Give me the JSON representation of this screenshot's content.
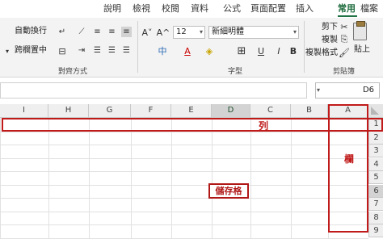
{
  "ribbon_tabs": [
    "檔案",
    "常用",
    "插入",
    "頁面配置",
    "公式",
    "資料",
    "校閱",
    "檢視",
    "說明"
  ],
  "active_tab": "常用",
  "groups": {
    "clipboard": {
      "label": "剪貼簿",
      "paste": "貼上",
      "cut": "剪下",
      "copy": "複製",
      "format_painter": "複製格式"
    },
    "font": {
      "label": "字型",
      "font_name": "新細明體",
      "font_size": "12",
      "bold": "B",
      "italic": "I",
      "underline": "U",
      "grow": "A^",
      "shrink": "A˅",
      "phonetic": "中"
    },
    "alignment": {
      "label": "對齊方式",
      "wrap_text": "自動換行",
      "merge_center": "跨欄置中"
    }
  },
  "name_box": "D6",
  "columns": [
    "A",
    "B",
    "C",
    "D",
    "E",
    "F",
    "G",
    "H",
    "I"
  ],
  "selected_column": "D",
  "rows": [
    "1",
    "2",
    "3",
    "4",
    "5",
    "6",
    "7",
    "8",
    "9"
  ],
  "selected_row": "6",
  "annotations": {
    "row_label": "列",
    "column_label": "欄",
    "cell_label": "儲存格"
  },
  "colors": {
    "accent": "#217346",
    "annotation_red": "#c01a1a",
    "header_bg": "#efefef",
    "selected_header_bg": "#d3d3d3"
  }
}
